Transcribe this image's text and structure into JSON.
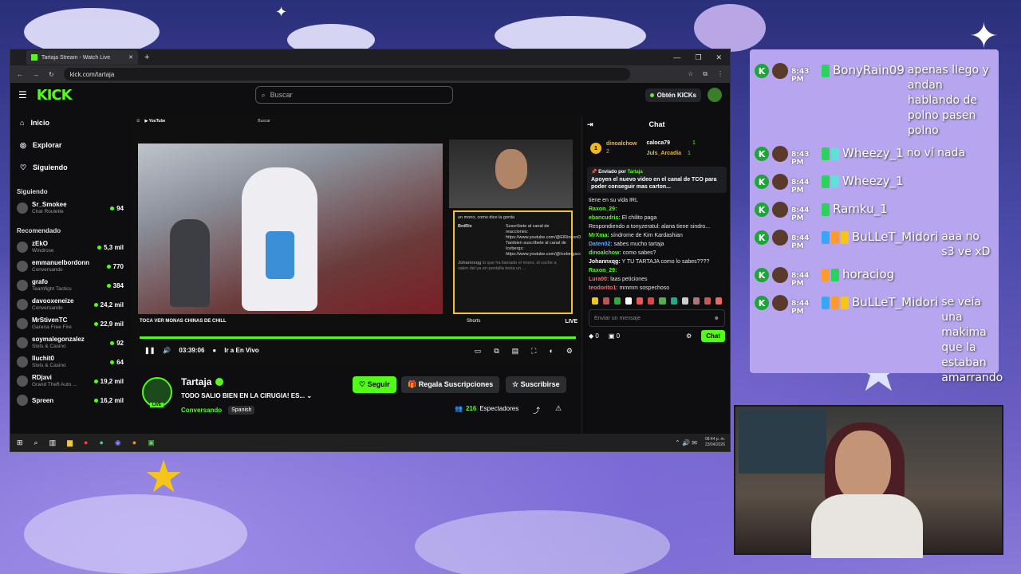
{
  "browser": {
    "tab_title": "Tartaja Stream - Watch Live",
    "url": "kick.com/tartaja"
  },
  "kick": {
    "logo": "KICK",
    "search_placeholder": "Buscar",
    "kicks_button": "Obtén KICKs",
    "nav": [
      {
        "label": "Inicio",
        "icon": "home-icon"
      },
      {
        "label": "Explorar",
        "icon": "compass-icon"
      },
      {
        "label": "Siguiendo",
        "icon": "heart-icon"
      }
    ],
    "following_header": "Siguiendo",
    "following": [
      {
        "name": "Sr_Smokee",
        "sub": "Chat Roulette",
        "count": "94"
      }
    ],
    "recommended_header": "Recomendado",
    "recommended": [
      {
        "name": "zEkO",
        "sub": "Windrose",
        "count": "5,3 mil"
      },
      {
        "name": "emmanuelbordonn",
        "sub": "Conversando",
        "count": "770"
      },
      {
        "name": "grafo",
        "sub": "Teamfight Tactics",
        "count": "384"
      },
      {
        "name": "davooxeneize",
        "sub": "Conversando",
        "count": "24,2 mil"
      },
      {
        "name": "MrStivenTC",
        "sub": "Garena Free Fire",
        "count": "22,9 mil"
      },
      {
        "name": "soymalegonzalez",
        "sub": "Slots & Casino",
        "count": "92"
      },
      {
        "name": "lluchit0",
        "sub": "Slots & Casino",
        "count": "64"
      },
      {
        "name": "RDjavi",
        "sub": "Grand Theft Auto ...",
        "count": "19,2 mil"
      },
      {
        "name": "Spreen",
        "sub": "",
        "count": "16,2 mil"
      }
    ]
  },
  "player": {
    "yt_search": "Buscar",
    "video_title": "TOCA VER MONAS CHINAS DE CHILL",
    "shorts_label": "Shorts",
    "live_label": "LIVE",
    "progress": 1.0,
    "time": "03:39:06",
    "go_live": "Ir a En Vivo",
    "yt_chat": [
      {
        "user": "",
        "text": "un mono, como dice la gorda"
      },
      {
        "user": "BotRix",
        "text": "Suscríbete al canal de reacciones: https://www.youtube.com/@ElRinconDeTartaja Tambien suscríbete al canal de Icebergs: https://www.youtube.com/@IcebergsconTartaja"
      },
      {
        "user": "Johannxqg",
        "text": "lo que ha llamado el mono, el coche a valen del ya en pantalla tenía un ..."
      }
    ]
  },
  "stream": {
    "streamer": "Tartaja",
    "live_badge": "LIVE",
    "title": "TODO SALIO BIEN EN LA CIRUGIA! ES...",
    "category": "Conversando",
    "language": "Spanish",
    "follow": "Seguir",
    "gift": "Regala Suscripciones",
    "subscribe": "Suscribirse",
    "viewers": "216",
    "viewers_label": "Espectadores"
  },
  "chat": {
    "header": "Chat",
    "top_gifter": {
      "name": "dinoalchow",
      "rank": "1",
      "count": "2"
    },
    "gifters": [
      {
        "name": "caloca79",
        "count": "1"
      },
      {
        "name": "Juls_Arcadia",
        "count": "1"
      }
    ],
    "pinned_by_label": "Enviado por",
    "pinned_by": "Tartaja",
    "pinned_text": "Apoyen el nuevo video en el canal de TCO para poder conseguir mas carton...",
    "messages": [
      {
        "user": "",
        "color": "#ffffff",
        "text": "tiene en su vida IRL"
      },
      {
        "user": "Raxon_29:",
        "color": "#53fc18",
        "text": ""
      },
      {
        "user": "ebancudris:",
        "color": "#53fc18",
        "text": "El chilito paga"
      },
      {
        "user": "",
        "color": "#888888",
        "text": "Respondiendo a tonyzeratul: alana tiene sindro..."
      },
      {
        "user": "MrXma:",
        "color": "#53fc18",
        "text": "síndrome de Kim Kardashian"
      },
      {
        "user": "Daten02:",
        "color": "#5fa8ff",
        "text": "sabes mucho tartaja"
      },
      {
        "user": "dinoalchow:",
        "color": "#53fc18",
        "text": "como sabes?"
      },
      {
        "user": "Johannxqg:",
        "color": "#ffffff",
        "text": "Y TU TARTAJA como lo sabes????"
      },
      {
        "user": "Raxon_29:",
        "color": "#53fc18",
        "text": ""
      },
      {
        "user": "Lura00:",
        "color": "#ff6b6b",
        "text": "laas peticiones"
      },
      {
        "user": "teodorito1:",
        "color": "#ff6b6b",
        "text": "mmmm sospechoso"
      }
    ],
    "input_placeholder": "Enviar un mensaje",
    "kicks_count": "0",
    "subs_count": "0",
    "send": "Chat"
  },
  "taskbar": {
    "time": "08:44 p. m.",
    "date": "23/04/2026"
  },
  "overlay_chat": [
    {
      "time": "8:43 PM",
      "user": "BonyRain09",
      "text": "apenas llego y andan hablando de polno pasen polno",
      "badges": [
        "#2bd35c"
      ]
    },
    {
      "time": "8:43 PM",
      "user": "Wheezy_1",
      "text": "no ví nada",
      "badges": [
        "#2bd35c",
        "#5fe0d8"
      ]
    },
    {
      "time": "8:44 PM",
      "user": "Wheezy_1",
      "text": "",
      "badges": [
        "#2bd35c",
        "#5fe0d8"
      ]
    },
    {
      "time": "8:44 PM",
      "user": "Ramku_1",
      "text": "",
      "badges": [
        "#2bd35c"
      ]
    },
    {
      "time": "8:44 PM",
      "user": "BuLLeT_Midori",
      "text": "aaa no s3 ve xD",
      "badges": [
        "#3aa5f5",
        "#ff9a2e",
        "#f5c518"
      ]
    },
    {
      "time": "8:44 PM",
      "user": "horaciog",
      "text": "",
      "badges": [
        "#ff9a2e",
        "#2bd35c"
      ]
    },
    {
      "time": "8:44 PM",
      "user": "BuLLeT_Midori",
      "text": "se veía una makima que la estaban amarrando",
      "badges": [
        "#3aa5f5",
        "#ff9a2e",
        "#f5c518"
      ]
    }
  ]
}
